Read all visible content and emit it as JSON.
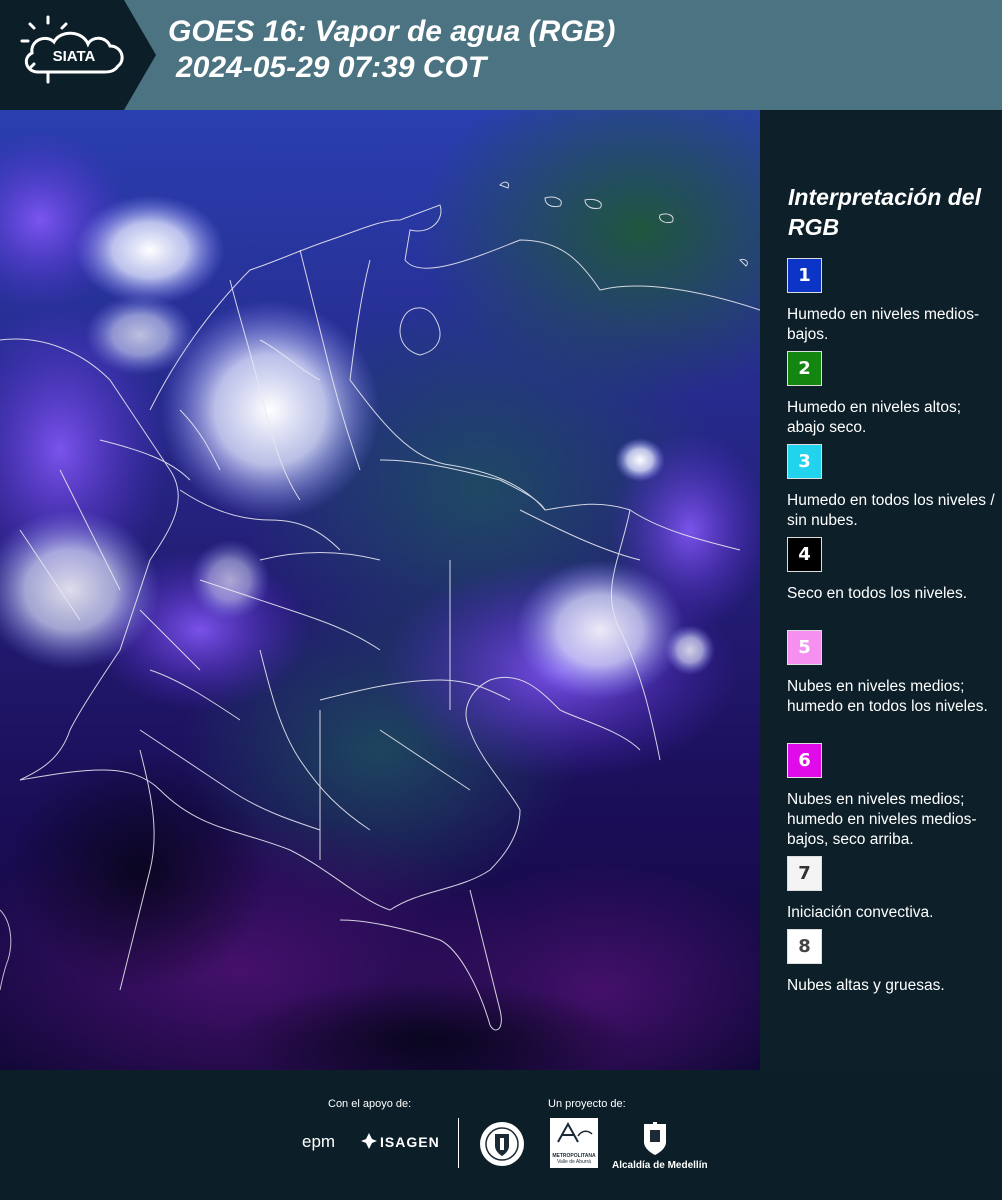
{
  "header": {
    "logo_text": "SIATA",
    "title_line1": "GOES 16: Vapor de agua (RGB)",
    "title_line2": "2024-05-29 07:39 COT"
  },
  "legend": {
    "title": "Interpretación del RGB",
    "items": [
      {
        "number": "1",
        "color": "#0c35c8",
        "text_color": "#ffffff",
        "text": "Humedo en niveles medios-bajos."
      },
      {
        "number": "2",
        "color": "#12860f",
        "text_color": "#ffffff",
        "text": "Humedo en niveles altos; abajo seco."
      },
      {
        "number": "3",
        "color": "#22d3ee",
        "text_color": "#ffffff",
        "text": "Humedo en todos los niveles / sin nubes."
      },
      {
        "number": "4",
        "color": "#000000",
        "text_color": "#ffffff",
        "text": "Seco en todos los niveles."
      },
      {
        "number": "5",
        "color": "#f590f0",
        "text_color": "#ffffff",
        "text": "Nubes en niveles medios; humedo en todos los niveles."
      },
      {
        "number": "6",
        "color": "#e00be8",
        "text_color": "#ffffff",
        "text": "Nubes en niveles medios; humedo en niveles medios-bajos, seco arriba."
      },
      {
        "number": "7",
        "color": "#f4f4f4",
        "text_color": "#333333",
        "text": "Iniciación convectiva."
      },
      {
        "number": "8",
        "color": "#ffffff",
        "text_color": "#444444",
        "text": "Nubes altas y gruesas."
      }
    ]
  },
  "footer": {
    "support_label": "Con el apoyo de:",
    "project_label": "Un proyecto de:",
    "sponsors": [
      "epm",
      "ISAGEN"
    ],
    "area_metro_text": "METROPOLITANA",
    "area_metro_sub": "Valle de Aburrá",
    "alcaldia_text": "Alcaldía de Medellín"
  },
  "colors": {
    "header_bg": "#4b7381",
    "page_bg": "#0c1f29"
  }
}
